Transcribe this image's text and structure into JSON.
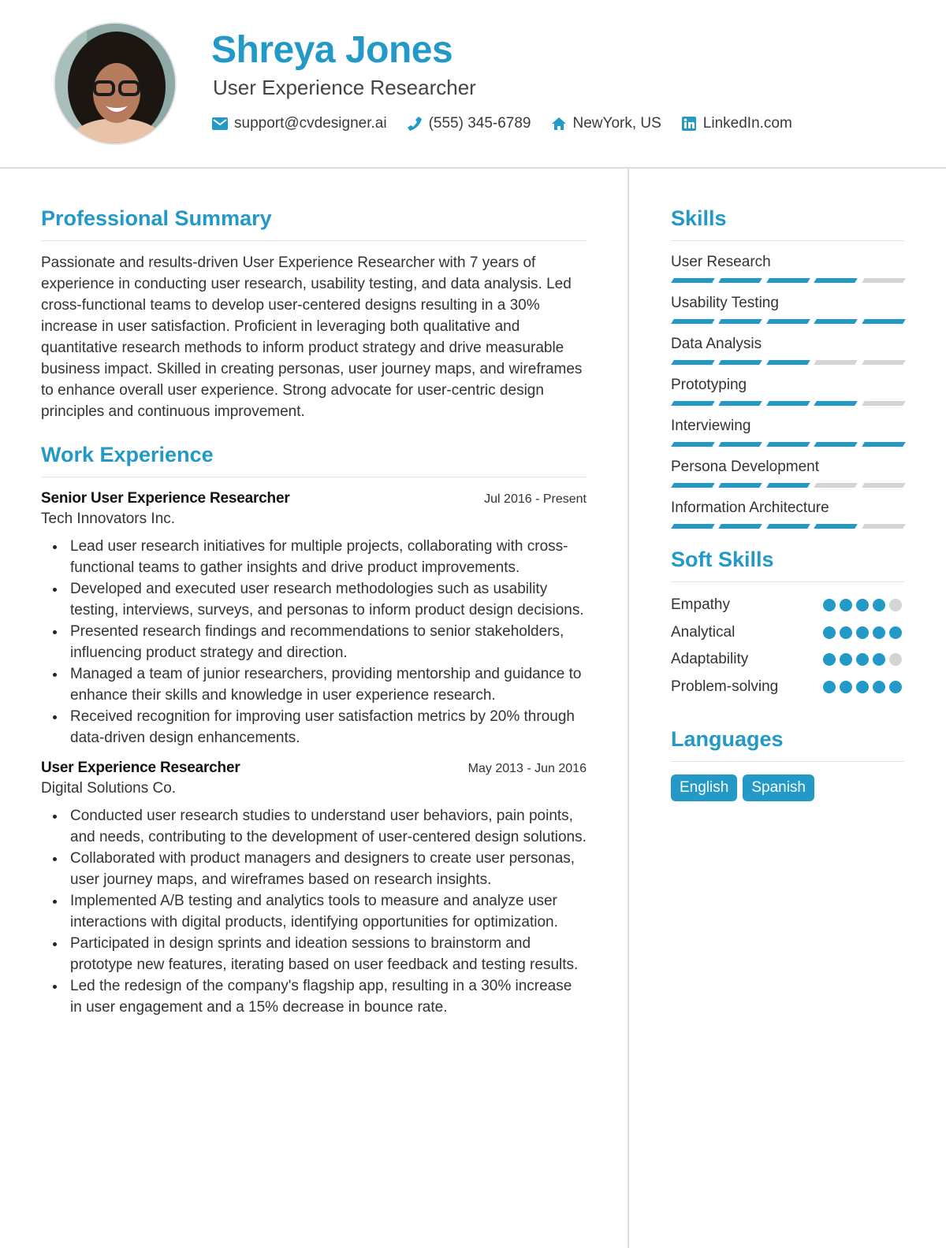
{
  "header": {
    "name": "Shreya Jones",
    "title": "User Experience Researcher",
    "contacts": [
      {
        "icon": "envelope-icon",
        "text": "support@cvdesigner.ai"
      },
      {
        "icon": "phone-icon",
        "text": "(555) 345-6789"
      },
      {
        "icon": "home-icon",
        "text": "NewYork, US"
      },
      {
        "icon": "linkedin-icon",
        "text": "LinkedIn.com"
      }
    ]
  },
  "colors": {
    "accent": "#2399c7",
    "inactive": "#d4d4d4",
    "text": "#333333"
  },
  "summary": {
    "title": "Professional Summary",
    "text": "Passionate and results-driven User Experience Researcher with 7 years of experience in conducting user research, usability testing, and data analysis. Led cross-functional teams to develop user-centered designs resulting in a 30% increase in user satisfaction. Proficient in leveraging both qualitative and quantitative research methods to inform product strategy and drive measurable business impact. Skilled in creating personas, user journey maps, and wireframes to enhance overall user experience. Strong advocate for user-centric design principles and continuous improvement."
  },
  "experience": {
    "title": "Work Experience",
    "jobs": [
      {
        "title": "Senior User Experience Researcher",
        "date": "Jul 2016 - Present",
        "company": "Tech Innovators Inc.",
        "bullets": [
          "Lead user research initiatives for multiple projects, collaborating with cross-functional teams to gather insights and drive product improvements.",
          "Developed and executed user research methodologies such as usability testing, interviews, surveys, and personas to inform product design decisions.",
          "Presented research findings and recommendations to senior stakeholders, influencing product strategy and direction.",
          "Managed a team of junior researchers, providing mentorship and guidance to enhance their skills and knowledge in user experience research.",
          "Received recognition for improving user satisfaction metrics by 20% through data-driven design enhancements."
        ]
      },
      {
        "title": "User Experience Researcher",
        "date": "May 2013 - Jun 2016",
        "company": "Digital Solutions Co.",
        "bullets": [
          "Conducted user research studies to understand user behaviors, pain points, and needs, contributing to the development of user-centered design solutions.",
          "Collaborated with product managers and designers to create user personas, user journey maps, and wireframes based on research insights.",
          "Implemented A/B testing and analytics tools to measure and analyze user interactions with digital products, identifying opportunities for optimization.",
          "Participated in design sprints and ideation sessions to brainstorm and prototype new features, iterating based on user feedback and testing results.",
          "Led the redesign of the company's flagship app, resulting in a 30% increase in user engagement and a 15% decrease in bounce rate."
        ]
      }
    ]
  },
  "skills": {
    "title": "Skills",
    "max": 5,
    "items": [
      {
        "name": "User Research",
        "level": 4
      },
      {
        "name": "Usability Testing",
        "level": 5
      },
      {
        "name": "Data Analysis",
        "level": 3
      },
      {
        "name": "Prototyping",
        "level": 4
      },
      {
        "name": "Interviewing",
        "level": 5
      },
      {
        "name": "Persona Development",
        "level": 3
      },
      {
        "name": "Information Architecture",
        "level": 4
      }
    ]
  },
  "soft_skills": {
    "title": "Soft Skills",
    "max": 5,
    "items": [
      {
        "name": "Empathy",
        "level": 4
      },
      {
        "name": "Analytical",
        "level": 5
      },
      {
        "name": "Adaptability",
        "level": 4
      },
      {
        "name": "Problem-solving",
        "level": 5
      }
    ]
  },
  "languages": {
    "title": "Languages",
    "items": [
      "English",
      "Spanish"
    ]
  }
}
